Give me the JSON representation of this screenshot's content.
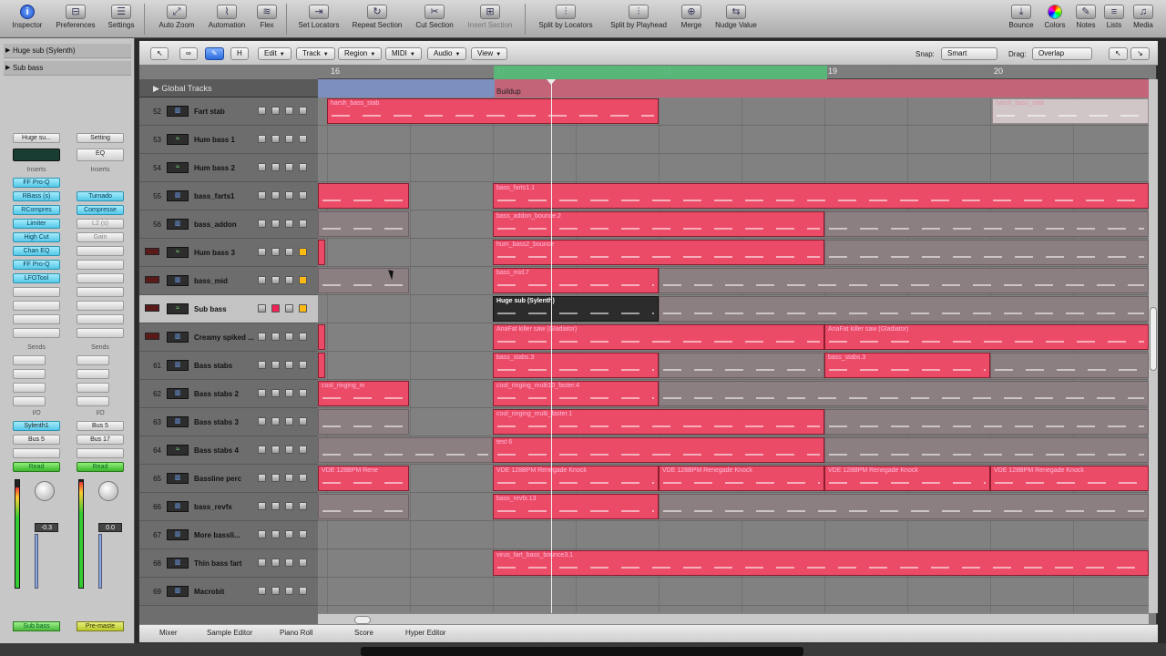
{
  "toolbar": {
    "inspector": "Inspector",
    "preferences": "Preferences",
    "settings": "Settings",
    "auto_zoom": "Auto Zoom",
    "automation": "Automation",
    "flex": "Flex",
    "set_locators": "Set Locators",
    "repeat_section": "Repeat Section",
    "cut_section": "Cut Section",
    "insert_section": "Insert Section",
    "split_by_locators": "Split by Locators",
    "split_by_playhead": "Split by Playhead",
    "merge": "Merge",
    "nudge_value": "Nudge Value",
    "bounce": "Bounce",
    "colors": "Colors",
    "notes": "Notes",
    "lists": "Lists",
    "media": "Media"
  },
  "inspector": {
    "region1": "Huge sub (Sylenth)",
    "region2": "Sub bass",
    "stripA": {
      "setting": "Huge su...",
      "inserts_label": "Inserts",
      "plugins": [
        "FF Pro-Q",
        "RBass (s)",
        "RCompres",
        "Limiter",
        "High Cut",
        "Chan EQ",
        "FF Pro-Q",
        "LFOTool"
      ],
      "sends_label": "Sends",
      "io_label": "I/O",
      "input": "Sylenth1",
      "output": "Bus 5",
      "automation": "Read",
      "volume": "-0.3",
      "name": "Sub bass"
    },
    "stripB": {
      "setting": "Setting",
      "eq": "EQ",
      "inserts_label": "Inserts",
      "plugins": [
        "Turnado",
        "Compresse",
        "L2 (s)",
        "Gain"
      ],
      "sends_label": "Sends",
      "io_label": "I/O",
      "input": "Bus 5",
      "output": "Bus 17",
      "automation": "Read",
      "volume": "0.0",
      "name": "Pre-maste"
    }
  },
  "localbar": {
    "edit": "Edit",
    "track": "Track",
    "region": "Region",
    "midi": "MIDI",
    "audio": "Audio",
    "view": "View",
    "snap_label": "Snap:",
    "snap_value": "Smart",
    "drag_label": "Drag:",
    "drag_value": "Overlap"
  },
  "ruler": {
    "bars": [
      "16",
      "17",
      "18",
      "19",
      "20"
    ]
  },
  "global_tracks": "Global Tracks",
  "marker": "Buildup",
  "tracks": [
    {
      "num": "52",
      "name": "Fart stab",
      "type": "midi"
    },
    {
      "num": "53",
      "name": "Hum bass 1",
      "type": "aud"
    },
    {
      "num": "54",
      "name": "Hum bass 2",
      "type": "aud"
    },
    {
      "num": "55",
      "name": "bass_farts1",
      "type": "midi"
    },
    {
      "num": "56",
      "name": "bass_addon",
      "type": "midi"
    },
    {
      "num": "",
      "name": "Hum bass 3",
      "type": "aud",
      "rec": true,
      "solo": true
    },
    {
      "num": "",
      "name": "bass_mid",
      "type": "midi",
      "rec": true,
      "solo": true
    },
    {
      "num": "",
      "name": "Sub bass",
      "type": "aud",
      "rec": true,
      "selected": true
    },
    {
      "num": "",
      "name": "Creamy spiked ...",
      "type": "midi",
      "rec": true
    },
    {
      "num": "61",
      "name": "Bass stabs",
      "type": "midi"
    },
    {
      "num": "62",
      "name": "Bass stabs 2",
      "type": "midi"
    },
    {
      "num": "63",
      "name": "Bass stabs 3",
      "type": "midi"
    },
    {
      "num": "64",
      "name": "Bass stabs 4",
      "type": "aud"
    },
    {
      "num": "65",
      "name": "Bassline perc",
      "type": "midi"
    },
    {
      "num": "66",
      "name": "bass_revfx",
      "type": "midi"
    },
    {
      "num": "67",
      "name": "More bassli...",
      "type": "midi"
    },
    {
      "num": "68",
      "name": "Thin bass fart",
      "type": "midi"
    },
    {
      "num": "69",
      "name": "Macrobit",
      "type": "midi"
    }
  ],
  "regions": {
    "harsh_bass_stab": "harsh_bass_stab",
    "bass_farts": "bass_farts1.1",
    "bass_addon": "bass_addon_bounce.2",
    "hum_bass": "hum_bass2_bounce",
    "bass_mid": "bass_mid.7",
    "huge_sub": "Huge sub (Sylenth)",
    "anafat": "AnaFat killer saw (Gladiator)",
    "bass_stabs": "bass_stabs.3",
    "cool_ringing": "cool_ringing_m",
    "cool_ringing_long": "cool_ringing_multi10_faster.4",
    "cool_ringing_3": "cool_ringing_multi_faster.1",
    "test": "test 6",
    "vde": "VDE 128BPM Renegade Knock",
    "vde_short": "VDE 128BPM Rene",
    "bass_revfx": "bass_revfx.13",
    "virus": "virus_fart_bass_bounce3.1"
  },
  "bottom": {
    "mixer": "Mixer",
    "sample_editor": "Sample Editor",
    "piano_roll": "Piano Roll",
    "score": "Score",
    "hyper_editor": "Hyper Editor"
  }
}
